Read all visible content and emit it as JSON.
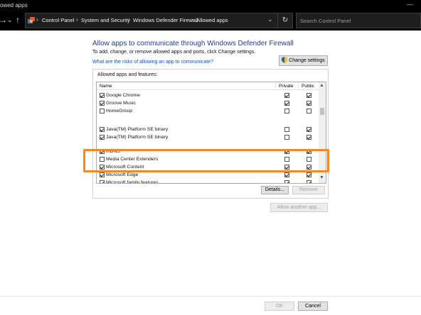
{
  "window": {
    "title": "owed apps"
  },
  "addressbar": {
    "crumbs": [
      "Control Panel",
      "System and Security",
      "Windows Defender Firewall",
      "Allowed apps"
    ],
    "search_placeholder": "Search Control Panel"
  },
  "page": {
    "heading": "Allow apps to communicate through Windows Defender Firewall",
    "subtext": "To add, change, or remove allowed apps and ports, click Change settings.",
    "risk_link": "What are the risks of allowing an app to communicate?",
    "change_settings": "Change settings"
  },
  "list": {
    "group_label": "Allowed apps and features:",
    "columns": {
      "name": "Name",
      "private": "Private",
      "public": "Public"
    },
    "rows": [
      {
        "name": "Google Chrome",
        "enabled": true,
        "private": true,
        "public": true
      },
      {
        "name": "Groove Music",
        "enabled": true,
        "private": true,
        "public": true
      },
      {
        "name": "HomeGroup",
        "enabled": false,
        "private": false,
        "public": false
      },
      {
        "name": "Java(TM) Platform SE binary",
        "enabled": true,
        "private": false,
        "public": true
      },
      {
        "name": "Java(TM) Platform SE binary",
        "enabled": true,
        "private": false,
        "public": true
      },
      {
        "name": "mDNS",
        "enabled": true,
        "private": true,
        "public": true
      },
      {
        "name": "Media Center Extenders",
        "enabled": false,
        "private": false,
        "public": false
      },
      {
        "name": "Microsoft Content",
        "enabled": true,
        "private": true,
        "public": true
      },
      {
        "name": "Microsoft Edge",
        "enabled": true,
        "private": true,
        "public": true
      },
      {
        "name": "Microsoft family features",
        "enabled": true,
        "private": true,
        "public": true
      }
    ]
  },
  "buttons": {
    "details": "Details...",
    "remove": "Remove",
    "allow_another": "Allow another app...",
    "ok": "OK",
    "cancel": "Cancel"
  },
  "colors": {
    "highlight": "#f08a24",
    "heading": "#1e3c8c",
    "link": "#0a4fc0"
  }
}
